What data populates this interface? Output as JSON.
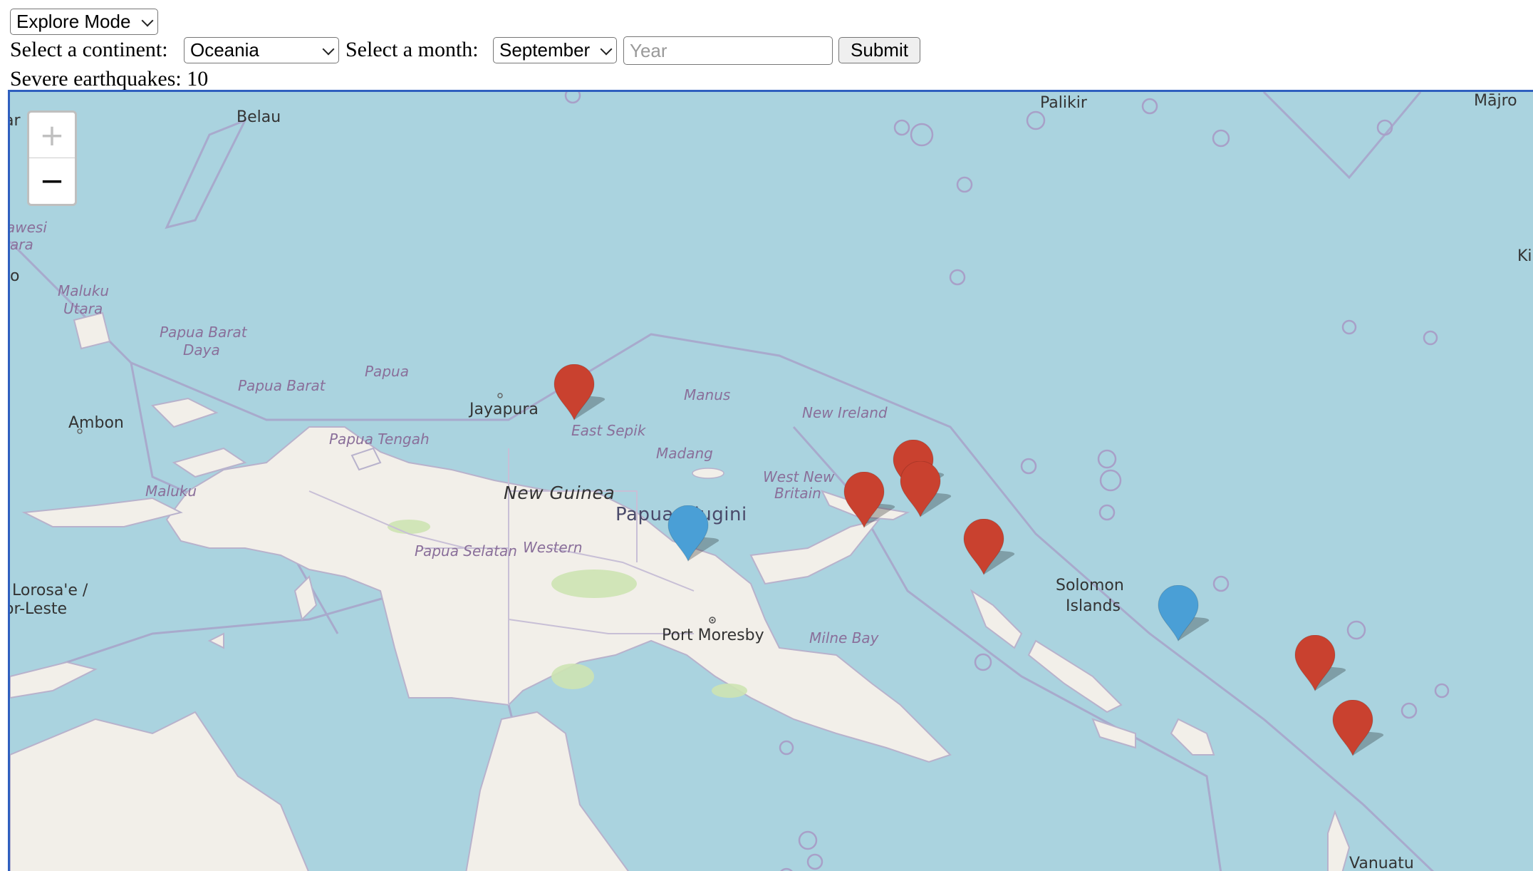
{
  "mode": {
    "selected": "Explore Mode"
  },
  "filters": {
    "continent_label": "Select a continent:",
    "continent_value": "Oceania",
    "month_label": "Select a month:",
    "month_value": "September",
    "year_value": "",
    "year_placeholder": "Year",
    "submit_label": "Submit"
  },
  "summary": {
    "text": "Severe earthquakes: 10"
  },
  "map": {
    "zoom_in": "+",
    "zoom_out": "−",
    "labels": {
      "belau": "Belau",
      "palikir": "Palikir",
      "majro": "Mājro",
      "ki": "Ki",
      "sar": "Sar",
      "sulawesi": "awesi",
      "ara": "ara",
      "o": "o",
      "maluku_utara_1": "Maluku",
      "maluku_utara_2": "Utara",
      "papua_barat_daya_1": "Papua Barat",
      "papua_barat_daya_2": "Daya",
      "papua": "Papua",
      "papua_barat": "Papua Barat",
      "ambon": "Ambon",
      "maluku": "Maluku",
      "papua_tengah": "Papua Tengah",
      "jayapura": "Jayapura",
      "east_sepik": "East Sepik",
      "manus": "Manus",
      "madang": "Madang",
      "new_ireland": "New Ireland",
      "west_new_britain_1": "West New",
      "west_new_britain_2": "Britain",
      "new_guinea": "New Guinea",
      "papua_niugini": "Papua Niugini",
      "papua_selatan": "Papua Selatan",
      "western": "Western",
      "lorosae_1": "Lorosa'e /",
      "lorosae_2": "or-Leste",
      "port_moresby": "Port Moresby",
      "milne_bay": "Milne Bay",
      "solomon_1": "Solomon",
      "solomon_2": "Islands",
      "vanuatu": "Vanuatu"
    },
    "marker_colors": {
      "severe": "#c9412f",
      "other": "#4a9fd6"
    },
    "markers": [
      {
        "name": "marker-east-sepik",
        "type": "severe"
      },
      {
        "name": "marker-new-ireland-north",
        "type": "severe"
      },
      {
        "name": "marker-new-ireland",
        "type": "severe"
      },
      {
        "name": "marker-new-britain",
        "type": "severe"
      },
      {
        "name": "marker-bougainville",
        "type": "severe"
      },
      {
        "name": "marker-madang",
        "type": "other"
      },
      {
        "name": "marker-solomon",
        "type": "other"
      },
      {
        "name": "marker-vanuatu-north",
        "type": "severe"
      },
      {
        "name": "marker-vanuatu",
        "type": "severe"
      }
    ]
  }
}
